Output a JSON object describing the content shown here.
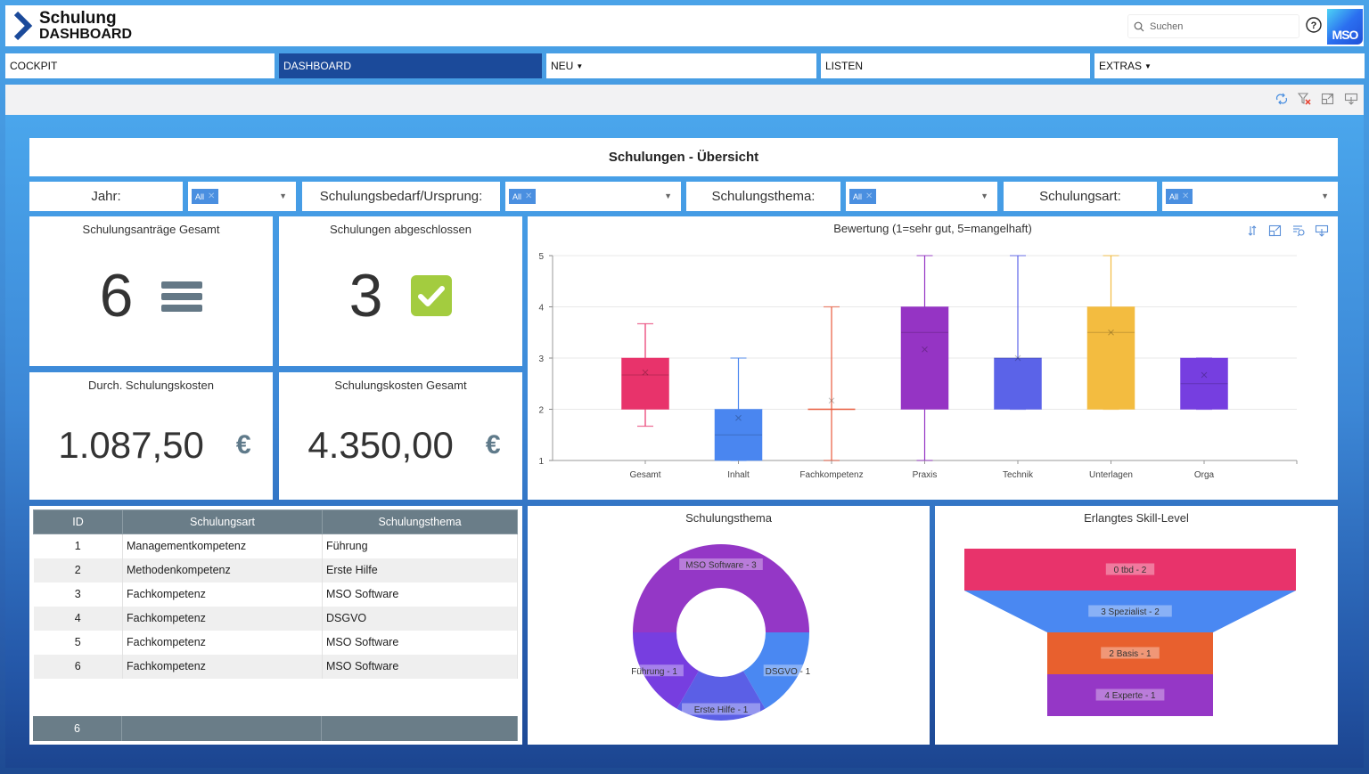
{
  "header": {
    "title": "Schulung",
    "subtitle": "DASHBOARD",
    "search_placeholder": "Suchen",
    "logo_text": "MSO"
  },
  "nav": [
    {
      "label": "COCKPIT",
      "active": false,
      "dropdown": false
    },
    {
      "label": "DASHBOARD",
      "active": true,
      "dropdown": false
    },
    {
      "label": "NEU",
      "active": false,
      "dropdown": true
    },
    {
      "label": "LISTEN",
      "active": false,
      "dropdown": false
    },
    {
      "label": "EXTRAS",
      "active": false,
      "dropdown": true
    }
  ],
  "toolbar_icons": [
    "refresh-icon",
    "clear-filter-icon",
    "expand-icon",
    "export-icon"
  ],
  "dashboard": {
    "title": "Schulungen - Übersicht",
    "filters": [
      {
        "label": "Jahr:",
        "value": "All"
      },
      {
        "label": "Schulungsbedarf/Ursprung:",
        "value": "All"
      },
      {
        "label": "Schulungsthema:",
        "value": "All"
      },
      {
        "label": "Schulungsart:",
        "value": "All"
      }
    ],
    "kpis": [
      {
        "title": "Schulungsanträge Gesamt",
        "value": "6",
        "icon": "list-icon"
      },
      {
        "title": "Schulungen abgeschlossen",
        "value": "3",
        "icon": "check-icon"
      },
      {
        "title": "Durch. Schulungskosten",
        "value": "1.087,50",
        "unit": "€"
      },
      {
        "title": "Schulungskosten Gesamt",
        "value": "4.350,00",
        "unit": "€"
      }
    ],
    "table": {
      "columns": [
        "ID",
        "Schulungsart",
        "Schulungsthema"
      ],
      "rows": [
        [
          "1",
          "Managementkompetenz",
          "Führung"
        ],
        [
          "2",
          "Methodenkompetenz",
          "Erste Hilfe"
        ],
        [
          "3",
          "Fachkompetenz",
          "MSO Software"
        ],
        [
          "4",
          "Fachkompetenz",
          "DSGVO"
        ],
        [
          "5",
          "Fachkompetenz",
          "MSO Software"
        ],
        [
          "6",
          "Fachkompetenz",
          "MSO Software"
        ]
      ],
      "footer": [
        "6",
        "",
        ""
      ]
    }
  },
  "chart_data": [
    {
      "type": "boxplot",
      "title": "Bewertung (1=sehr gut, 5=mangelhaft)",
      "ylim": [
        1,
        5
      ],
      "yticks": [
        1,
        2,
        3,
        4,
        5
      ],
      "categories": [
        "Gesamt",
        "Inhalt",
        "Fachkompetenz",
        "Praxis",
        "Technik",
        "Unterlagen",
        "Orga"
      ],
      "series": [
        {
          "name": "Gesamt",
          "min": 1.67,
          "q1": 2,
          "median": 2.67,
          "q3": 3,
          "max": 3.67,
          "mean": 2.72,
          "color": "#e8336b"
        },
        {
          "name": "Inhalt",
          "min": 1,
          "q1": 1,
          "median": 1.5,
          "q3": 2,
          "max": 3,
          "mean": 1.83,
          "color": "#4a86f0"
        },
        {
          "name": "Fachkompetenz",
          "min": 1,
          "q1": 2,
          "median": 2,
          "q3": 2,
          "max": 4,
          "mean": 2.17,
          "color": "#e85a3c"
        },
        {
          "name": "Praxis",
          "min": 1,
          "q1": 2,
          "median": 3.5,
          "q3": 4,
          "max": 5,
          "mean": 3.17,
          "color": "#9534c4"
        },
        {
          "name": "Technik",
          "min": 2,
          "q1": 2,
          "median": 3,
          "q3": 3,
          "max": 5,
          "mean": 3,
          "color": "#5b63e8"
        },
        {
          "name": "Unterlagen",
          "min": 2,
          "q1": 2,
          "median": 3.5,
          "q3": 4,
          "max": 5,
          "mean": 3.5,
          "color": "#f3bc40"
        },
        {
          "name": "Orga",
          "min": 2,
          "q1": 2,
          "median": 2.5,
          "q3": 3,
          "max": 3,
          "mean": 2.67,
          "color": "#763ee0"
        }
      ],
      "grid": true
    },
    {
      "type": "pie",
      "variant": "donut",
      "title": "Schulungsthema",
      "slices": [
        {
          "label": "MSO Software - 3",
          "name": "MSO Software",
          "value": 3,
          "color": "#9437c6"
        },
        {
          "label": "DSGVO - 1",
          "name": "DSGVO",
          "value": 1,
          "color": "#4a88f2"
        },
        {
          "label": "Erste Hilfe - 1",
          "name": "Erste Hilfe",
          "value": 1,
          "color": "#5b5fe6"
        },
        {
          "label": "Führung - 1",
          "name": "Führung",
          "value": 1,
          "color": "#773ee0"
        }
      ]
    },
    {
      "type": "funnel",
      "title": "Erlangtes Skill-Level",
      "stages": [
        {
          "label": "0 tbd - 2",
          "name": "0 tbd",
          "value": 2,
          "color": "#e8336b"
        },
        {
          "label": "3 Spezialist - 2",
          "name": "3 Spezialist",
          "value": 2,
          "color": "#4a88f2"
        },
        {
          "label": "2 Basis - 1",
          "name": "2 Basis",
          "value": 1,
          "color": "#e8602e"
        },
        {
          "label": "4 Experte - 1",
          "name": "4 Experte",
          "value": 1,
          "color": "#9537c6"
        }
      ]
    }
  ]
}
